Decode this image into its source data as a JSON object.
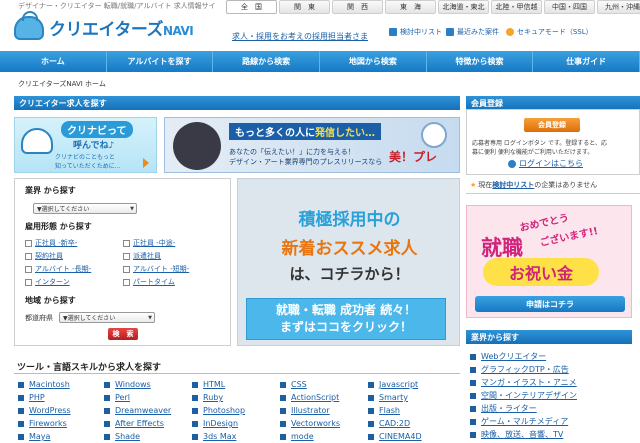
{
  "header": {
    "tagline": "デザイナー・クリエイター 転職/就職/アルバイト 求人情報サイ",
    "logo_main": "クリエイターズ",
    "logo_sub": "NAVI",
    "recruit_link": "求人・採用をお考えの採用担当者さま",
    "util_links": [
      "検討中リスト",
      "最近みた案件",
      "セキュアモード（SSL）"
    ]
  },
  "regions": [
    "全　国",
    "関　東",
    "関　西",
    "東　海",
    "北海道・東北",
    "北陸・甲信越",
    "中国・四国",
    "九州・沖縄"
  ],
  "nav": [
    "ホーム",
    "アルバイトを探す",
    "路線から検索",
    "地図から検索",
    "特徴から検索",
    "仕事ガイド"
  ],
  "breadcrumb": "クリエイターズNAVI ホーム",
  "creator_search": {
    "title": "クリエイター求人を探す",
    "banner1": {
      "line1": "クリナビって",
      "line2": "呼んでね♪",
      "line3": "クリナビのこともっと",
      "line4": "知っていただくために…"
    },
    "banner2": {
      "headline_a": "もっと多くの人に",
      "headline_b": "発信したい…",
      "body1": "あなたの「伝えたい！」に力を与える！",
      "body2": "デザイン・アート業界専門のプレスリリースなら",
      "brand": "美！プレ"
    }
  },
  "search_form": {
    "industry_label": "業界 から探す",
    "industry_placeholder": "▼選択してください",
    "employment_label": "雇用形態 から探す",
    "employment_options": [
      "正社員 -新卒-",
      "正社員 -中途-",
      "契約社員",
      "派遣社員",
      "アルバイト -長期-",
      "アルバイト -短期-",
      "インターン",
      "パートタイム"
    ],
    "area_label": "地域 から探す",
    "prefecture_label": "都道府県",
    "prefecture_placeholder": "▼選択してください",
    "search_button": "検　索"
  },
  "promo": {
    "line1": "積極採用中の",
    "line2": "新着おススメ求人",
    "line3": "は、コチラから！",
    "button_line1": "就職・転職 成功者 続々！",
    "button_line2": "まずはココをクリック！"
  },
  "tools": {
    "title": "ツール・言語スキルから求人を探す",
    "rows": [
      [
        "Macintosh",
        "Windows",
        "HTML",
        "CSS",
        "Javascript"
      ],
      [
        "PHP",
        "Perl",
        "Ruby",
        "ActionScript",
        "Smarty"
      ],
      [
        "WordPress",
        "Dreamweaver",
        "Photoshop",
        "Illustrator",
        "Flash"
      ],
      [
        "Fireworks",
        "After Effects",
        "InDesign",
        "Vectorworks",
        "CAD:2D"
      ],
      [
        "Maya",
        "Shade",
        "3ds Max",
        "mode",
        "CINEMA4D"
      ]
    ]
  },
  "member": {
    "title": "会員登録",
    "button": "会員登録",
    "desc1": "応募者専用 ログインボタン です。登録すると、応",
    "desc2": "募に便利 便利な機能がご利用いただけます。",
    "login_link": "ログインはこちら"
  },
  "watchlist": {
    "prefix": "現在",
    "link": "検討中リスト",
    "suffix": "の企業はありません"
  },
  "celebrate": {
    "line1": "おめでとう",
    "line2": "ございます!!",
    "line3": "就職",
    "line4": "お祝い金",
    "button": "申請はコチラ"
  },
  "industry_nav": {
    "title": "業界から探す",
    "items": [
      "Webクリエイター",
      "グラフィックDTP・広告",
      "マンガ・イラスト・アニメ",
      "空間・インテリアデザイン",
      "出版・ライター",
      "ゲーム・マルチメディア",
      "映像、放送、音響、TV"
    ]
  },
  "colors": {
    "primary": "#1679c4",
    "accent_red": "#c8202a",
    "accent_orange": "#e8750f",
    "promo_blue": "#4bb7ea"
  }
}
